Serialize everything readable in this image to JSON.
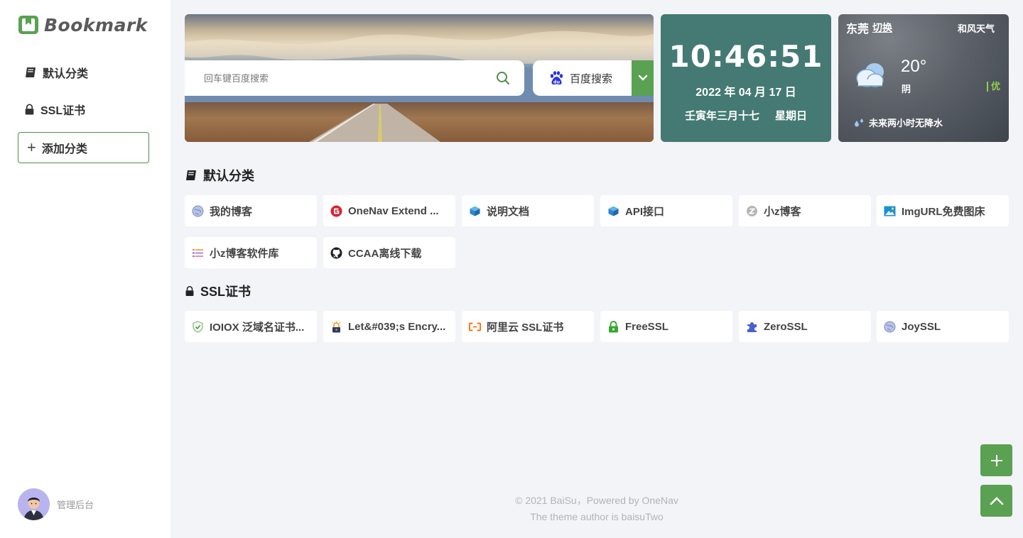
{
  "sidebar": {
    "logo_text": "Bookmark",
    "items": [
      {
        "label": "默认分类",
        "icon": "book-icon"
      },
      {
        "label": "SSL证书",
        "icon": "lock-icon"
      }
    ],
    "add_category_label": "添加分类",
    "admin_label": "管理后台"
  },
  "search": {
    "placeholder": "回车键百度搜索",
    "engine_label": "百度搜索"
  },
  "clock": {
    "time": "10:46:51",
    "date": "2022 年 04 月 17 日",
    "lunar": "壬寅年三月十七",
    "weekday": "星期日"
  },
  "weather": {
    "city": "东莞",
    "switch_label": "切换",
    "provider": "和风天气",
    "temperature": "20°",
    "condition": "阴",
    "air_quality": "优",
    "forecast": "未来两小时无降水"
  },
  "sections": [
    {
      "title": "默认分类",
      "icon": "book-icon",
      "links": [
        {
          "label": "我的博客",
          "icon": "globe-icon"
        },
        {
          "label": "OneNav Extend ...",
          "icon": "onenav-icon"
        },
        {
          "label": "说明文档",
          "icon": "cube-icon"
        },
        {
          "label": "API接口",
          "icon": "cube-icon"
        },
        {
          "label": "小z博客",
          "icon": "z-icon"
        },
        {
          "label": "ImgURL免费图床",
          "icon": "image-icon"
        },
        {
          "label": "小z博客软件库",
          "icon": "list-icon"
        },
        {
          "label": "CCAA离线下载",
          "icon": "github-icon"
        }
      ]
    },
    {
      "title": "SSL证书",
      "icon": "lock-icon",
      "links": [
        {
          "label": "IOIOX 泛域名证书...",
          "icon": "shield-icon"
        },
        {
          "label": "Let&#039;s Encry...",
          "icon": "letsencrypt-icon"
        },
        {
          "label": "阿里云 SSL证书",
          "icon": "aliyun-icon"
        },
        {
          "label": "FreeSSL",
          "icon": "lock-green-icon"
        },
        {
          "label": "ZeroSSL",
          "icon": "puzzle-icon"
        },
        {
          "label": "JoySSL",
          "icon": "globe-icon"
        }
      ]
    }
  ],
  "footer": {
    "line1": "© 2021 BaiSu，Powered by OneNav",
    "line2": "The theme author is baisuTwo"
  },
  "colors": {
    "accent": "#5aa152",
    "clock_bg": "#447a73",
    "page_bg": "#f3f4f8"
  }
}
